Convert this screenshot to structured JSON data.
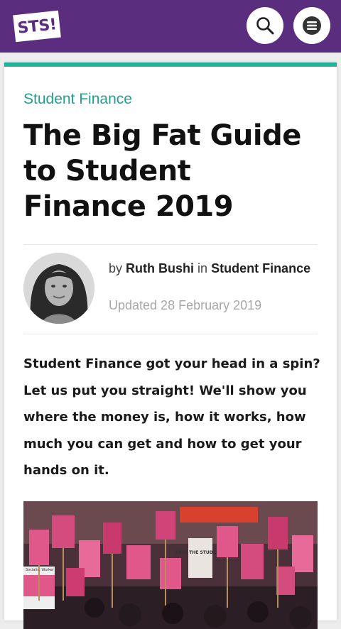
{
  "header": {
    "logo_text": "STS!",
    "brand_color": "#5b2d7e",
    "search_icon": "search-icon",
    "menu_icon": "hamburger-menu-icon"
  },
  "article": {
    "category": "Student Finance",
    "title": "The Big Fat Guide to Student Finance 2019",
    "byline": {
      "by": "by",
      "author": "Ruth Bushi",
      "in": "in",
      "category_link": "Student Finance",
      "updated": "Updated 28 February 2019"
    },
    "intro": "Student Finance got your head in a spin? Let us put you straight! We'll show you where the money is, how it works, how much you can get and how to get your hands on it.",
    "hero_placard_text": "SAVE THE STUDENTS",
    "hero_sign_text": "Socialist Worker"
  },
  "colors": {
    "accent": "#22b299",
    "category_text": "#22a08f"
  }
}
